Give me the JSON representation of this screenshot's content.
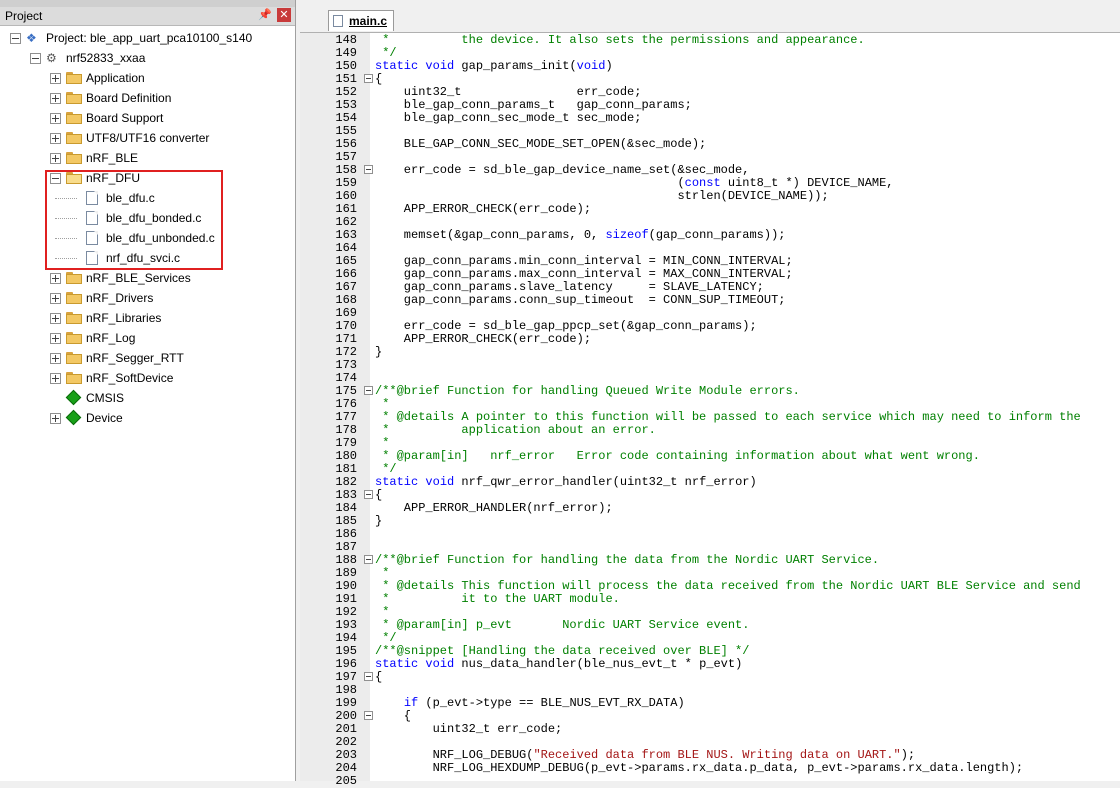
{
  "project_panel": {
    "title": "Project",
    "pin_icon": "pin-icon",
    "close_icon": "close-icon",
    "tree": [
      {
        "label": "Project: ble_app_uart_pca10100_s140",
        "icon": "project-icon"
      },
      {
        "label": "nrf52833_xxaa",
        "icon": "target-icon"
      },
      {
        "label": "Application",
        "icon": "folder-icon"
      },
      {
        "label": "Board Definition",
        "icon": "folder-icon"
      },
      {
        "label": "Board Support",
        "icon": "folder-icon"
      },
      {
        "label": "UTF8/UTF16 converter",
        "icon": "folder-icon"
      },
      {
        "label": "nRF_BLE",
        "icon": "folder-icon"
      },
      {
        "label": "nRF_DFU",
        "icon": "folder-open-icon"
      },
      {
        "label": "ble_dfu.c",
        "icon": "file-icon"
      },
      {
        "label": "ble_dfu_bonded.c",
        "icon": "file-icon"
      },
      {
        "label": "ble_dfu_unbonded.c",
        "icon": "file-icon"
      },
      {
        "label": "nrf_dfu_svci.c",
        "icon": "file-icon"
      },
      {
        "label": "nRF_BLE_Services",
        "icon": "folder-icon"
      },
      {
        "label": "nRF_Drivers",
        "icon": "folder-icon"
      },
      {
        "label": "nRF_Libraries",
        "icon": "folder-icon"
      },
      {
        "label": "nRF_Log",
        "icon": "folder-icon"
      },
      {
        "label": "nRF_Segger_RTT",
        "icon": "folder-icon"
      },
      {
        "label": "nRF_SoftDevice",
        "icon": "folder-icon"
      },
      {
        "label": "CMSIS",
        "icon": "component-icon"
      },
      {
        "label": "Device",
        "icon": "component-icon"
      }
    ]
  },
  "editor": {
    "tab_label": "main.c",
    "highlight_color": "#e02020",
    "lines": [
      {
        "n": "148",
        "t": " *          the device. It also sets the permissions and appearance."
      },
      {
        "n": "149",
        "t": " */"
      },
      {
        "n": "150",
        "t": "static void gap_params_init(void)"
      },
      {
        "n": "151",
        "t": "{"
      },
      {
        "n": "152",
        "t": "    uint32_t                err_code;"
      },
      {
        "n": "153",
        "t": "    ble_gap_conn_params_t   gap_conn_params;"
      },
      {
        "n": "154",
        "t": "    ble_gap_conn_sec_mode_t sec_mode;"
      },
      {
        "n": "155",
        "t": ""
      },
      {
        "n": "156",
        "t": "    BLE_GAP_CONN_SEC_MODE_SET_OPEN(&sec_mode);"
      },
      {
        "n": "157",
        "t": ""
      },
      {
        "n": "158",
        "t": "    err_code = sd_ble_gap_device_name_set(&sec_mode,"
      },
      {
        "n": "159",
        "t": "                                          (const uint8_t *) DEVICE_NAME,"
      },
      {
        "n": "160",
        "t": "                                          strlen(DEVICE_NAME));"
      },
      {
        "n": "161",
        "t": "    APP_ERROR_CHECK(err_code);"
      },
      {
        "n": "162",
        "t": ""
      },
      {
        "n": "163",
        "t": "    memset(&gap_conn_params, 0, sizeof(gap_conn_params));"
      },
      {
        "n": "164",
        "t": ""
      },
      {
        "n": "165",
        "t": "    gap_conn_params.min_conn_interval = MIN_CONN_INTERVAL;"
      },
      {
        "n": "166",
        "t": "    gap_conn_params.max_conn_interval = MAX_CONN_INTERVAL;"
      },
      {
        "n": "167",
        "t": "    gap_conn_params.slave_latency     = SLAVE_LATENCY;"
      },
      {
        "n": "168",
        "t": "    gap_conn_params.conn_sup_timeout  = CONN_SUP_TIMEOUT;"
      },
      {
        "n": "169",
        "t": ""
      },
      {
        "n": "170",
        "t": "    err_code = sd_ble_gap_ppcp_set(&gap_conn_params);"
      },
      {
        "n": "171",
        "t": "    APP_ERROR_CHECK(err_code);"
      },
      {
        "n": "172",
        "t": "}"
      },
      {
        "n": "173",
        "t": ""
      },
      {
        "n": "174",
        "t": ""
      },
      {
        "n": "175",
        "t": "/**@brief Function for handling Queued Write Module errors."
      },
      {
        "n": "176",
        "t": " *"
      },
      {
        "n": "177",
        "t": " * @details A pointer to this function will be passed to each service which may need to inform the"
      },
      {
        "n": "178",
        "t": " *          application about an error."
      },
      {
        "n": "179",
        "t": " *"
      },
      {
        "n": "180",
        "t": " * @param[in]   nrf_error   Error code containing information about what went wrong."
      },
      {
        "n": "181",
        "t": " */"
      },
      {
        "n": "182",
        "t": "static void nrf_qwr_error_handler(uint32_t nrf_error)"
      },
      {
        "n": "183",
        "t": "{"
      },
      {
        "n": "184",
        "t": "    APP_ERROR_HANDLER(nrf_error);"
      },
      {
        "n": "185",
        "t": "}"
      },
      {
        "n": "186",
        "t": ""
      },
      {
        "n": "187",
        "t": ""
      },
      {
        "n": "188",
        "t": "/**@brief Function for handling the data from the Nordic UART Service."
      },
      {
        "n": "189",
        "t": " *"
      },
      {
        "n": "190",
        "t": " * @details This function will process the data received from the Nordic UART BLE Service and send"
      },
      {
        "n": "191",
        "t": " *          it to the UART module."
      },
      {
        "n": "192",
        "t": " *"
      },
      {
        "n": "193",
        "t": " * @param[in] p_evt       Nordic UART Service event."
      },
      {
        "n": "194",
        "t": " */"
      },
      {
        "n": "195",
        "t": "/**@snippet [Handling the data received over BLE] */"
      },
      {
        "n": "196",
        "t": "static void nus_data_handler(ble_nus_evt_t * p_evt)"
      },
      {
        "n": "197",
        "t": "{"
      },
      {
        "n": "198",
        "t": ""
      },
      {
        "n": "199",
        "t": "    if (p_evt->type == BLE_NUS_EVT_RX_DATA)"
      },
      {
        "n": "200",
        "t": "    {"
      },
      {
        "n": "201",
        "t": "        uint32_t err_code;"
      },
      {
        "n": "202",
        "t": ""
      },
      {
        "n": "203",
        "t": "        NRF_LOG_DEBUG(\"Received data from BLE NUS. Writing data on UART.\");"
      },
      {
        "n": "204",
        "t": "        NRF_LOG_HEXDUMP_DEBUG(p_evt->params.rx_data.p_data, p_evt->params.rx_data.length);"
      },
      {
        "n": "205",
        "t": ""
      }
    ]
  }
}
